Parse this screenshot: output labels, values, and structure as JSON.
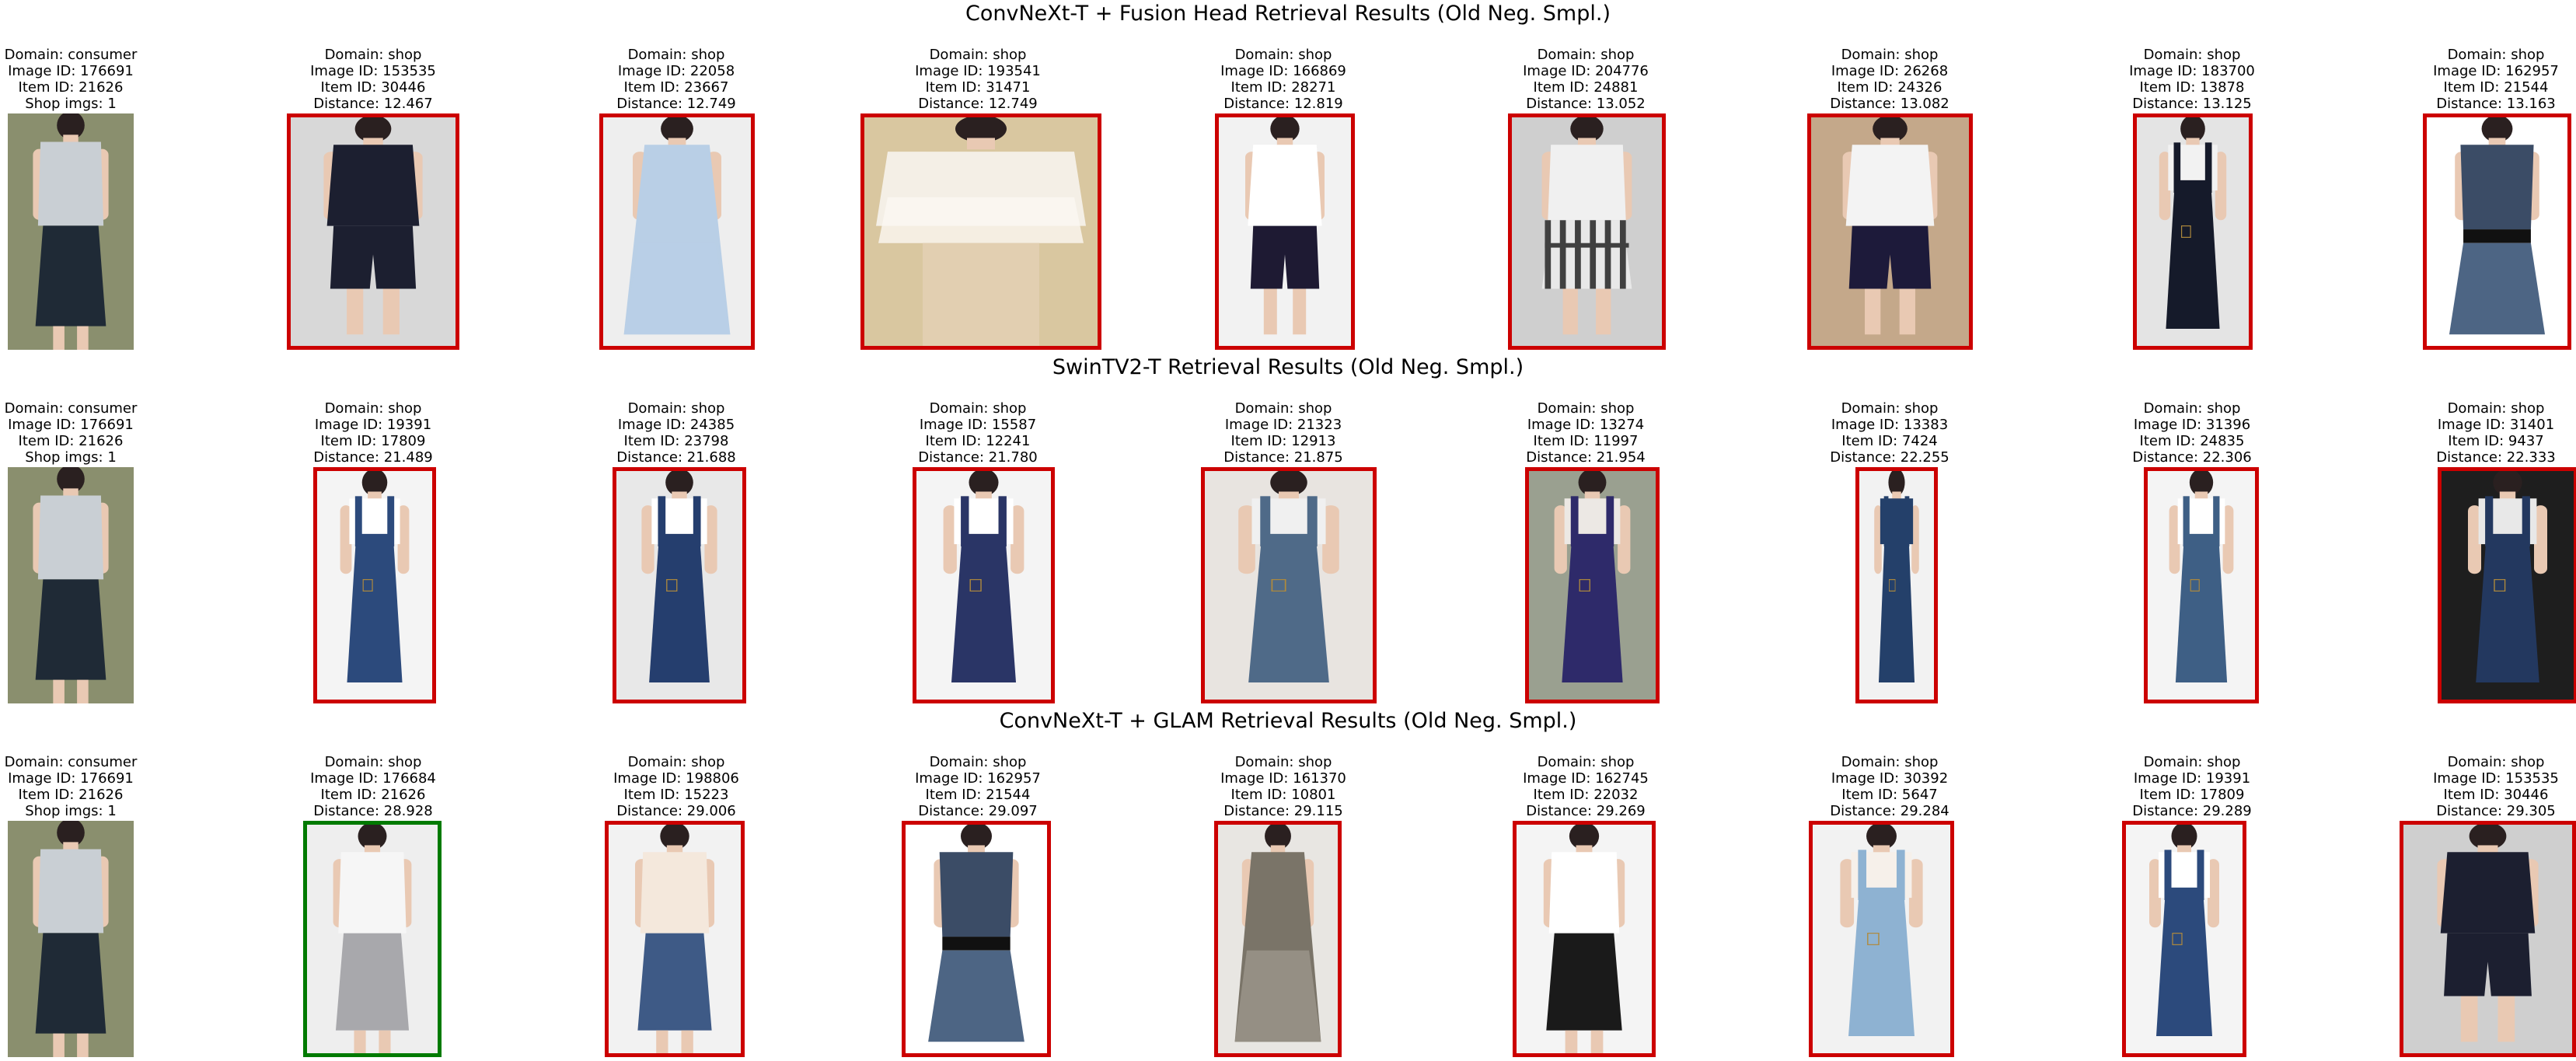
{
  "colors": {
    "miss": "#cc0000",
    "match": "#007a00"
  },
  "rows": [
    {
      "title": "ConvNeXt-T + Fusion Head Retrieval Results (Old Neg. Smpl.)",
      "items": [
        {
          "lines": [
            "Domain: consumer",
            "Image ID: 176691",
            "Item ID: 21626",
            "Shop imgs: 1"
          ],
          "status": "query",
          "garment": "skirt",
          "bg": "#8a8f6e",
          "top": "#c9cfd4",
          "bottom": "#1f2a36"
        },
        {
          "lines": [
            "Domain: shop",
            "Image ID: 153535",
            "Item ID: 30446",
            "Distance: 12.467"
          ],
          "status": "miss",
          "garment": "dark-set",
          "bg": "#d8d8d8",
          "top": "#1c1f30",
          "bottom": "#1c1f30"
        },
        {
          "lines": [
            "Domain: shop",
            "Image ID: 22058",
            "Item ID: 23667",
            "Distance: 12.749"
          ],
          "status": "miss",
          "garment": "dress",
          "bg": "#eeeeee",
          "top": "#b9cfe6",
          "bottom": "#b9cfe6"
        },
        {
          "lines": [
            "Domain: shop",
            "Image ID: 193541",
            "Item ID: 31471",
            "Distance: 12.749"
          ],
          "status": "miss",
          "garment": "crop-top",
          "bg": "#d9c7a0",
          "top": "#f4efe6",
          "bottom": "#e2cfb1"
        },
        {
          "lines": [
            "Domain: shop",
            "Image ID: 166869",
            "Item ID: 28271",
            "Distance: 12.819"
          ],
          "status": "miss",
          "garment": "shorts",
          "bg": "#f2f2f2",
          "top": "#ffffff",
          "bottom": "#1e1a33"
        },
        {
          "lines": [
            "Domain: shop",
            "Image ID: 204776",
            "Item ID: 24881",
            "Distance: 13.052"
          ],
          "status": "miss",
          "garment": "plaid",
          "bg": "#cfcfcf",
          "top": "#f0f0f0",
          "bottom": "#404040"
        },
        {
          "lines": [
            "Domain: shop",
            "Image ID: 26268",
            "Item ID: 24326",
            "Distance: 13.082"
          ],
          "status": "miss",
          "garment": "dark-set",
          "bg": "#c4a88a",
          "top": "#f3f3f3",
          "bottom": "#1d1a3a"
        },
        {
          "lines": [
            "Domain: shop",
            "Image ID: 183700",
            "Item ID: 13878",
            "Distance: 13.125"
          ],
          "status": "miss",
          "garment": "strap-skirt",
          "bg": "#e4e4e4",
          "top": "#f2f2f2",
          "bottom": "#151a2a"
        },
        {
          "lines": [
            "Domain: shop",
            "Image ID: 162957",
            "Item ID: 21544",
            "Distance: 13.163"
          ],
          "status": "miss",
          "garment": "denim-dress",
          "bg": "#ffffff",
          "top": "#3b4c66",
          "bottom": "#4d6584"
        }
      ]
    },
    {
      "title": "SwinTV2-T Retrieval Results (Old Neg. Smpl.)",
      "items": [
        {
          "lines": [
            "Domain: consumer",
            "Image ID: 176691",
            "Item ID: 21626",
            "Shop imgs: 1"
          ],
          "status": "query",
          "garment": "skirt",
          "bg": "#8a8f6e",
          "top": "#c9cfd4",
          "bottom": "#1f2a36"
        },
        {
          "lines": [
            "Domain: shop",
            "Image ID: 19391",
            "Item ID: 17809",
            "Distance: 21.489"
          ],
          "status": "miss",
          "garment": "overall",
          "bg": "#f4f4f4",
          "top": "#ffffff",
          "bottom": "#2c4a7c"
        },
        {
          "lines": [
            "Domain: shop",
            "Image ID: 24385",
            "Item ID: 23798",
            "Distance: 21.688"
          ],
          "status": "miss",
          "garment": "overall",
          "bg": "#e8e8e8",
          "top": "#ffffff",
          "bottom": "#253e6e"
        },
        {
          "lines": [
            "Domain: shop",
            "Image ID: 15587",
            "Item ID: 12241",
            "Distance: 21.780"
          ],
          "status": "miss",
          "garment": "overall",
          "bg": "#f4f4f4",
          "top": "#ffffff",
          "bottom": "#2a3566"
        },
        {
          "lines": [
            "Domain: shop",
            "Image ID: 21323",
            "Item ID: 12913",
            "Distance: 21.875"
          ],
          "status": "miss",
          "garment": "overall",
          "bg": "#e8e4e0",
          "top": "#f0f0f0",
          "bottom": "#4f6a88"
        },
        {
          "lines": [
            "Domain: shop",
            "Image ID: 13274",
            "Item ID: 11997",
            "Distance: 21.954"
          ],
          "status": "miss",
          "garment": "overall",
          "bg": "#9aa090",
          "top": "#ece8e4",
          "bottom": "#2e2a6a"
        },
        {
          "lines": [
            "Domain: shop",
            "Image ID: 13383",
            "Item ID: 7424",
            "Distance: 22.255"
          ],
          "status": "miss",
          "garment": "overall",
          "bg": "#f2f2f2",
          "top": "#24406a",
          "bottom": "#24406a"
        },
        {
          "lines": [
            "Domain: shop",
            "Image ID: 31396",
            "Item ID: 24835",
            "Distance: 22.306"
          ],
          "status": "miss",
          "garment": "overall",
          "bg": "#f4f4f4",
          "top": "#ffffff",
          "bottom": "#3e5f85"
        },
        {
          "lines": [
            "Domain: shop",
            "Image ID: 31401",
            "Item ID: 9437",
            "Distance: 22.333"
          ],
          "status": "miss",
          "garment": "overall",
          "bg": "#1e1e1e",
          "top": "#e8e8e8",
          "bottom": "#23385f"
        }
      ]
    },
    {
      "title": "ConvNeXt-T + GLAM Retrieval Results (Old Neg. Smpl.)",
      "items": [
        {
          "lines": [
            "Domain: consumer",
            "Image ID: 176691",
            "Item ID: 21626",
            "Shop imgs: 1"
          ],
          "status": "query",
          "garment": "skirt",
          "bg": "#8a8f6e",
          "top": "#c9cfd4",
          "bottom": "#1f2a36"
        },
        {
          "lines": [
            "Domain: shop",
            "Image ID: 176684",
            "Item ID: 21626",
            "Distance: 28.928"
          ],
          "status": "match",
          "garment": "skirt",
          "bg": "#eeeeee",
          "top": "#f6f6f6",
          "bottom": "#a8a8ac"
        },
        {
          "lines": [
            "Domain: shop",
            "Image ID: 198806",
            "Item ID: 15223",
            "Distance: 29.006"
          ],
          "status": "miss",
          "garment": "skirt",
          "bg": "#f2f2f2",
          "top": "#f4e8dc",
          "bottom": "#3e5a86"
        },
        {
          "lines": [
            "Domain: shop",
            "Image ID: 162957",
            "Item ID: 21544",
            "Distance: 29.097"
          ],
          "status": "miss",
          "garment": "denim-dress",
          "bg": "#ffffff",
          "top": "#3b4c66",
          "bottom": "#4d6584"
        },
        {
          "lines": [
            "Domain: shop",
            "Image ID: 161370",
            "Item ID: 10801",
            "Distance: 29.115"
          ],
          "status": "miss",
          "garment": "dress",
          "bg": "#e8e6e2",
          "top": "#7a7468",
          "bottom": "#9a948a"
        },
        {
          "lines": [
            "Domain: shop",
            "Image ID: 162745",
            "Item ID: 22032",
            "Distance: 29.269"
          ],
          "status": "miss",
          "garment": "skirt",
          "bg": "#f4f4f4",
          "top": "#ffffff",
          "bottom": "#1a1a1a"
        },
        {
          "lines": [
            "Domain: shop",
            "Image ID: 30392",
            "Item ID: 5647",
            "Distance: 29.284"
          ],
          "status": "miss",
          "garment": "overall",
          "bg": "#f2f2f2",
          "top": "#f6f0ea",
          "bottom": "#8eb2d2"
        },
        {
          "lines": [
            "Domain: shop",
            "Image ID: 19391",
            "Item ID: 17809",
            "Distance: 29.289"
          ],
          "status": "miss",
          "garment": "overall",
          "bg": "#f4f4f4",
          "top": "#ffffff",
          "bottom": "#2c4a7c"
        },
        {
          "lines": [
            "Domain: shop",
            "Image ID: 153535",
            "Item ID: 30446",
            "Distance: 29.305"
          ],
          "status": "miss",
          "garment": "dark-set",
          "bg": "#cfcfcf",
          "top": "#1c1f30",
          "bottom": "#1c1f30"
        }
      ]
    }
  ]
}
